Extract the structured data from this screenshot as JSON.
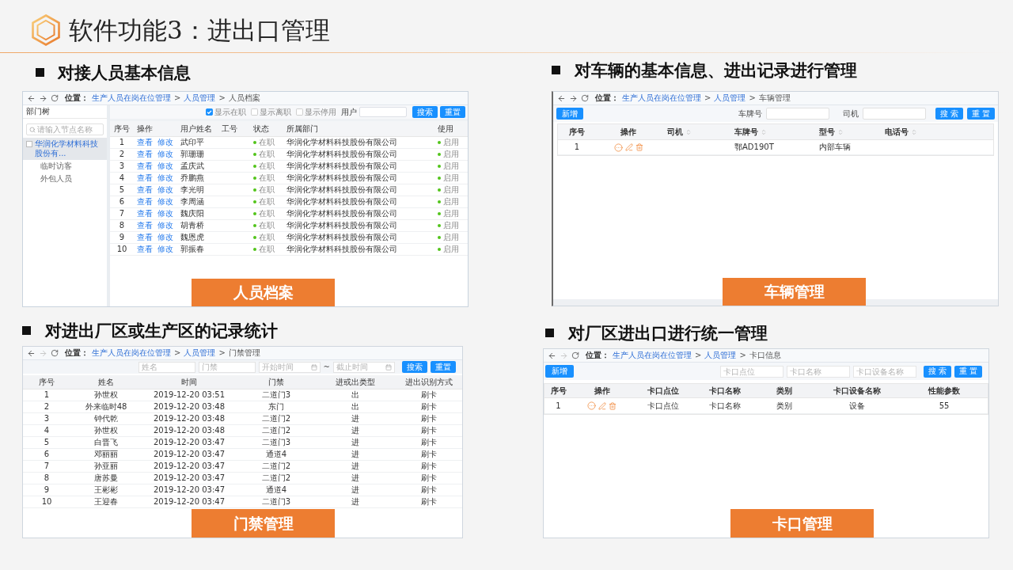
{
  "slide": {
    "title": "软件功能3：进出口管理"
  },
  "sections": [
    {
      "kind": "personnel",
      "heading": "对接人员基本信息",
      "caption": "人员档案",
      "screen": {
        "nav": {
          "forward_enabled": true,
          "label": "位置：",
          "crumbs": [
            {
              "kind": "link",
              "label": "生产人员在岗在位管理"
            },
            {
              "kind": "separator",
              "label": ">"
            },
            {
              "kind": "link",
              "label": "人员管理"
            },
            {
              "kind": "separator",
              "label": ">"
            },
            {
              "kind": "current",
              "label": "人员档案"
            }
          ]
        },
        "tree": {
          "title": "部门树",
          "search_placeholder": "请输入节点名称",
          "items": [
            {
              "label": "华润化学材料科技股份有...",
              "selected": true,
              "children": [
                {
                  "label": "临时访客",
                  "selected": false
                },
                {
                  "label": "外包人员",
                  "selected": false
                }
              ]
            }
          ]
        },
        "filters": [
          {
            "label": "显示在职",
            "checked": true
          },
          {
            "label": "显示离职",
            "checked": false
          },
          {
            "label": "显示停用",
            "checked": false
          }
        ],
        "user_label": "用户",
        "buttons": [
          "搜索",
          "重置"
        ],
        "columns": [
          "序号",
          "操作",
          "用户姓名",
          "工号",
          "状态",
          "所属部门",
          "使用"
        ],
        "rows": [
          {
            "no": "1",
            "actions": [
              "查看",
              "修改"
            ],
            "name": "武印平",
            "status": "在职",
            "department": "华润化学材料科技股份有限公司",
            "usage": "启用"
          },
          {
            "no": "2",
            "actions": [
              "查看",
              "修改"
            ],
            "name": "郭珊珊",
            "status": "在职",
            "department": "华润化学材料科技股份有限公司",
            "usage": "启用"
          },
          {
            "no": "3",
            "actions": [
              "查看",
              "修改"
            ],
            "name": "孟庆武",
            "status": "在职",
            "department": "华润化学材料科技股份有限公司",
            "usage": "启用"
          },
          {
            "no": "4",
            "actions": [
              "查看",
              "修改"
            ],
            "name": "乔鹏燕",
            "status": "在职",
            "department": "华润化学材料科技股份有限公司",
            "usage": "启用"
          },
          {
            "no": "5",
            "actions": [
              "查看",
              "修改"
            ],
            "name": "李光明",
            "status": "在职",
            "department": "华润化学材料科技股份有限公司",
            "usage": "启用"
          },
          {
            "no": "6",
            "actions": [
              "查看",
              "修改"
            ],
            "name": "李周涵",
            "status": "在职",
            "department": "华润化学材料科技股份有限公司",
            "usage": "启用"
          },
          {
            "no": "7",
            "actions": [
              "查看",
              "修改"
            ],
            "name": "魏庆阳",
            "status": "在职",
            "department": "华润化学材料科技股份有限公司",
            "usage": "启用"
          },
          {
            "no": "8",
            "actions": [
              "查看",
              "修改"
            ],
            "name": "胡青桥",
            "status": "在职",
            "department": "华润化学材料科技股份有限公司",
            "usage": "启用"
          },
          {
            "no": "9",
            "actions": [
              "查看",
              "修改"
            ],
            "name": "魏恩虎",
            "status": "在职",
            "department": "华润化学材料科技股份有限公司",
            "usage": "启用"
          },
          {
            "no": "10",
            "actions": [
              "查看",
              "修改"
            ],
            "name": "郭振春",
            "status": "在职",
            "department": "华润化学材料科技股份有限公司",
            "usage": "启用"
          }
        ]
      }
    },
    {
      "kind": "vehicles",
      "heading": "对车辆的基本信息、进出记录进行管理",
      "caption": "车辆管理",
      "screen": {
        "nav": {
          "forward_enabled": true,
          "label": "位置：",
          "crumbs": [
            {
              "kind": "link",
              "label": "生产人员在岗在位管理"
            },
            {
              "kind": "separator",
              "label": ">"
            },
            {
              "kind": "link",
              "label": "人员管理"
            },
            {
              "kind": "separator",
              "label": ">"
            },
            {
              "kind": "current",
              "label": "车辆管理"
            }
          ]
        },
        "add_button": "新增",
        "fields": [
          {
            "label": "车牌号"
          },
          {
            "label": "司机"
          }
        ],
        "buttons": [
          "搜 索",
          "重 置"
        ],
        "columns": [
          {
            "label": "序号",
            "sortable": false
          },
          {
            "label": "操作",
            "sortable": false
          },
          {
            "label": "司机",
            "sortable": true
          },
          {
            "label": "车牌号",
            "sortable": true
          },
          {
            "label": "型号",
            "sortable": true
          },
          {
            "label": "电话号",
            "sortable": true
          }
        ],
        "rows": [
          {
            "no": "1",
            "plate": "鄂AD190T",
            "model": "内部车辆"
          }
        ]
      }
    },
    {
      "kind": "access",
      "heading": "对进出厂区或生产区的记录统计",
      "caption": "门禁管理",
      "screen": {
        "nav": {
          "forward_enabled": false,
          "label": "位置：",
          "crumbs": [
            {
              "kind": "link",
              "label": "生产人员在岗在位管理"
            },
            {
              "kind": "separator",
              "label": ">"
            },
            {
              "kind": "link",
              "label": "人员管理"
            },
            {
              "kind": "separator",
              "label": ">"
            },
            {
              "kind": "current",
              "label": "门禁管理"
            }
          ]
        },
        "fields": [
          {
            "kind": "text",
            "placeholder": "姓名"
          },
          {
            "kind": "text",
            "placeholder": "门禁"
          },
          {
            "kind": "date",
            "placeholder": "开始时间"
          },
          {
            "kind": "range_separator",
            "label": "~"
          },
          {
            "kind": "date",
            "placeholder": "截止时间"
          }
        ],
        "buttons": [
          "搜索",
          "重置"
        ],
        "columns": [
          "序号",
          "姓名",
          "时间",
          "门禁",
          "进或出类型",
          "进出识别方式"
        ],
        "rows": [
          {
            "no": "1",
            "name": "孙世权",
            "time": "2019-12-20 03:51",
            "gate": "二道门3",
            "direction": "出",
            "method": "刷卡"
          },
          {
            "no": "2",
            "name": "外来临时48",
            "time": "2019-12-20 03:48",
            "gate": "东门",
            "direction": "出",
            "method": "刷卡"
          },
          {
            "no": "3",
            "name": "钟代乾",
            "time": "2019-12-20 03:48",
            "gate": "二道门2",
            "direction": "进",
            "method": "刷卡"
          },
          {
            "no": "4",
            "name": "孙世权",
            "time": "2019-12-20 03:48",
            "gate": "二道门2",
            "direction": "进",
            "method": "刷卡"
          },
          {
            "no": "5",
            "name": "白晋飞",
            "time": "2019-12-20 03:47",
            "gate": "二道门3",
            "direction": "进",
            "method": "刷卡"
          },
          {
            "no": "6",
            "name": "邓丽丽",
            "time": "2019-12-20 03:47",
            "gate": "通道4",
            "direction": "进",
            "method": "刷卡"
          },
          {
            "no": "7",
            "name": "孙亚丽",
            "time": "2019-12-20 03:47",
            "gate": "二道门2",
            "direction": "进",
            "method": "刷卡"
          },
          {
            "no": "8",
            "name": "唐苏曼",
            "time": "2019-12-20 03:47",
            "gate": "二道门2",
            "direction": "进",
            "method": "刷卡"
          },
          {
            "no": "9",
            "name": "王彬彬",
            "time": "2019-12-20 03:47",
            "gate": "通道4",
            "direction": "进",
            "method": "刷卡"
          },
          {
            "no": "10",
            "name": "王迎春",
            "time": "2019-12-20 03:47",
            "gate": "二道门3",
            "direction": "进",
            "method": "刷卡"
          }
        ]
      }
    },
    {
      "kind": "checkpoints",
      "heading": "对厂区进出口进行统一管理",
      "caption": "卡口管理",
      "screen": {
        "nav": {
          "forward_enabled": false,
          "label": "位置：",
          "crumbs": [
            {
              "kind": "link",
              "label": "生产人员在岗在位管理"
            },
            {
              "kind": "separator",
              "label": ">"
            },
            {
              "kind": "link",
              "label": "人员管理"
            },
            {
              "kind": "separator",
              "label": ">"
            },
            {
              "kind": "current",
              "label": "卡口信息"
            }
          ]
        },
        "add_button": "新增",
        "fields": [
          {
            "placeholder": "卡口点位"
          },
          {
            "placeholder": "卡口名称"
          },
          {
            "placeholder": "卡口设备名称"
          }
        ],
        "buttons": [
          "搜 索",
          "重 置"
        ],
        "columns": [
          "序号",
          "操作",
          "卡口点位",
          "卡口名称",
          "类别",
          "卡口设备名称",
          "性能参数"
        ],
        "rows": [
          {
            "no": "1",
            "point": "卡口点位",
            "name": "卡口名称",
            "category": "类别",
            "device": "设备",
            "params": "55"
          }
        ]
      }
    }
  ]
}
